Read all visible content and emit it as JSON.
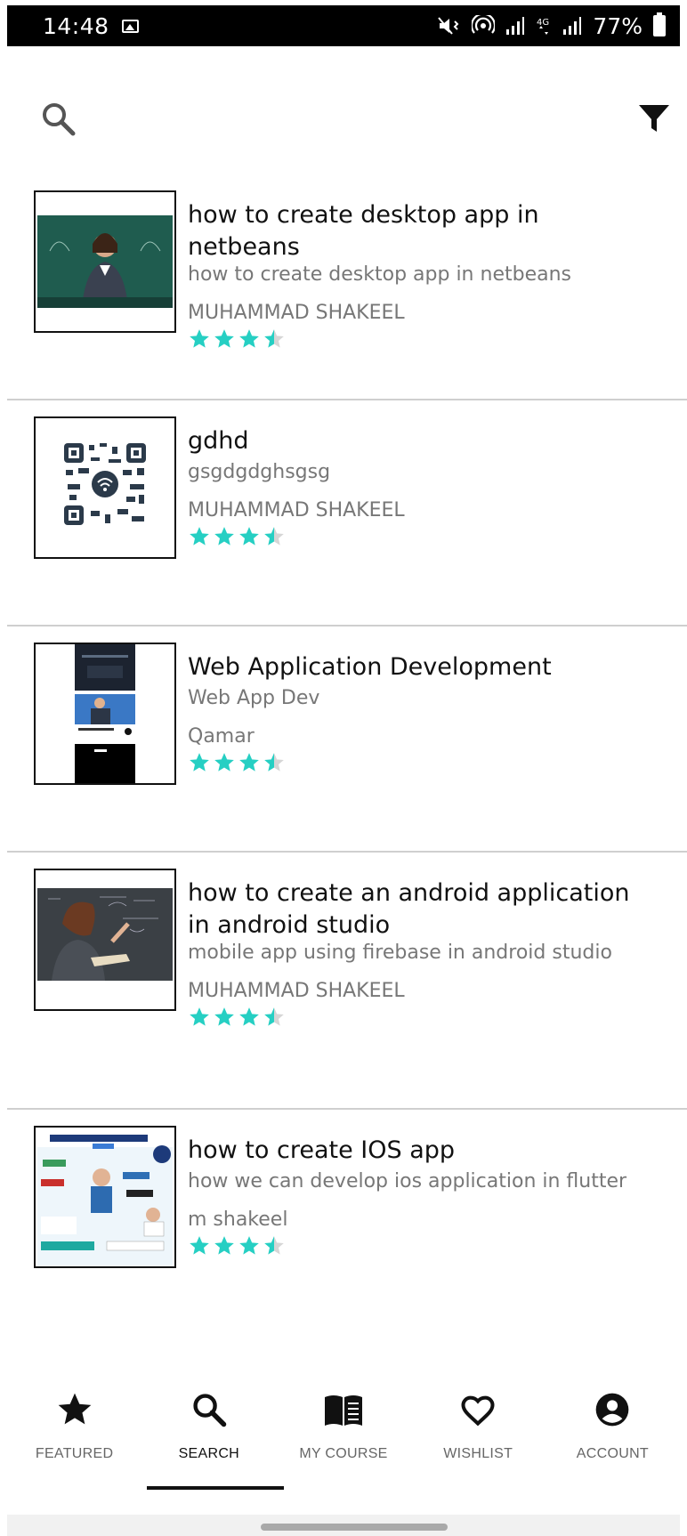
{
  "status_bar": {
    "time": "14:48",
    "battery": "77%"
  },
  "colors": {
    "star_filled": "#26cfc3",
    "star_empty": "#d6d6d6",
    "divider": "#cfcfcf",
    "text_secondary": "#777777"
  },
  "courses": [
    {
      "title": "how to create desktop app in netbeans",
      "subtitle": "how to create desktop app in netbeans",
      "author": "MUHAMMAD SHAKEEL",
      "rating": 3.5,
      "thumbnail": "teacher-chalkboard-image"
    },
    {
      "title": "gdhd",
      "subtitle": "gsgdgdghsgsg",
      "author": "MUHAMMAD SHAKEEL",
      "rating": 3.5,
      "thumbnail": "qr-code-image"
    },
    {
      "title": "Web Application Development",
      "subtitle": "Web App Dev",
      "author": "Qamar",
      "rating": 3.5,
      "thumbnail": "app-screenshot-image"
    },
    {
      "title": "how to create an android application in android studio",
      "subtitle": "mobile app using firebase in android studio",
      "author": "MUHAMMAD SHAKEEL",
      "rating": 3.5,
      "thumbnail": "teacher-book-image"
    },
    {
      "title": "how to create IOS app",
      "subtitle": "how we can develop ios application in flutter",
      "author": "m shakeel",
      "rating": 3.5,
      "thumbnail": "statistical-data-analysis-image"
    }
  ],
  "bottom_nav": {
    "items": [
      {
        "label": "FEATURED",
        "icon": "star-icon",
        "active": false
      },
      {
        "label": "SEARCH",
        "icon": "search-icon",
        "active": true
      },
      {
        "label": "MY COURSE",
        "icon": "book-icon",
        "active": false
      },
      {
        "label": "WISHLIST",
        "icon": "heart-icon",
        "active": false
      },
      {
        "label": "ACCOUNT",
        "icon": "account-icon",
        "active": false
      }
    ]
  }
}
